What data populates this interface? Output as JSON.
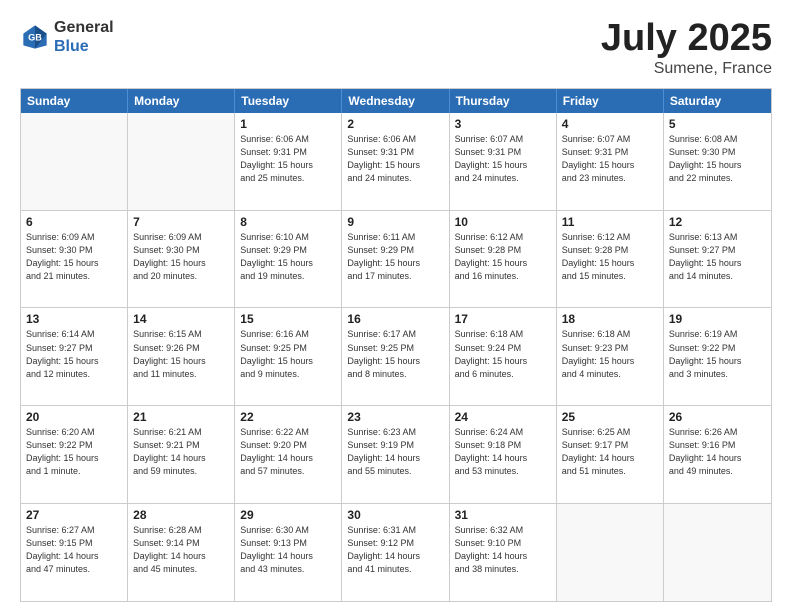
{
  "logo": {
    "general": "General",
    "blue": "Blue"
  },
  "title": {
    "month": "July 2025",
    "location": "Sumene, France"
  },
  "header_days": [
    "Sunday",
    "Monday",
    "Tuesday",
    "Wednesday",
    "Thursday",
    "Friday",
    "Saturday"
  ],
  "weeks": [
    [
      {
        "day": "",
        "info": ""
      },
      {
        "day": "",
        "info": ""
      },
      {
        "day": "1",
        "info": "Sunrise: 6:06 AM\nSunset: 9:31 PM\nDaylight: 15 hours\nand 25 minutes."
      },
      {
        "day": "2",
        "info": "Sunrise: 6:06 AM\nSunset: 9:31 PM\nDaylight: 15 hours\nand 24 minutes."
      },
      {
        "day": "3",
        "info": "Sunrise: 6:07 AM\nSunset: 9:31 PM\nDaylight: 15 hours\nand 24 minutes."
      },
      {
        "day": "4",
        "info": "Sunrise: 6:07 AM\nSunset: 9:31 PM\nDaylight: 15 hours\nand 23 minutes."
      },
      {
        "day": "5",
        "info": "Sunrise: 6:08 AM\nSunset: 9:30 PM\nDaylight: 15 hours\nand 22 minutes."
      }
    ],
    [
      {
        "day": "6",
        "info": "Sunrise: 6:09 AM\nSunset: 9:30 PM\nDaylight: 15 hours\nand 21 minutes."
      },
      {
        "day": "7",
        "info": "Sunrise: 6:09 AM\nSunset: 9:30 PM\nDaylight: 15 hours\nand 20 minutes."
      },
      {
        "day": "8",
        "info": "Sunrise: 6:10 AM\nSunset: 9:29 PM\nDaylight: 15 hours\nand 19 minutes."
      },
      {
        "day": "9",
        "info": "Sunrise: 6:11 AM\nSunset: 9:29 PM\nDaylight: 15 hours\nand 17 minutes."
      },
      {
        "day": "10",
        "info": "Sunrise: 6:12 AM\nSunset: 9:28 PM\nDaylight: 15 hours\nand 16 minutes."
      },
      {
        "day": "11",
        "info": "Sunrise: 6:12 AM\nSunset: 9:28 PM\nDaylight: 15 hours\nand 15 minutes."
      },
      {
        "day": "12",
        "info": "Sunrise: 6:13 AM\nSunset: 9:27 PM\nDaylight: 15 hours\nand 14 minutes."
      }
    ],
    [
      {
        "day": "13",
        "info": "Sunrise: 6:14 AM\nSunset: 9:27 PM\nDaylight: 15 hours\nand 12 minutes."
      },
      {
        "day": "14",
        "info": "Sunrise: 6:15 AM\nSunset: 9:26 PM\nDaylight: 15 hours\nand 11 minutes."
      },
      {
        "day": "15",
        "info": "Sunrise: 6:16 AM\nSunset: 9:25 PM\nDaylight: 15 hours\nand 9 minutes."
      },
      {
        "day": "16",
        "info": "Sunrise: 6:17 AM\nSunset: 9:25 PM\nDaylight: 15 hours\nand 8 minutes."
      },
      {
        "day": "17",
        "info": "Sunrise: 6:18 AM\nSunset: 9:24 PM\nDaylight: 15 hours\nand 6 minutes."
      },
      {
        "day": "18",
        "info": "Sunrise: 6:18 AM\nSunset: 9:23 PM\nDaylight: 15 hours\nand 4 minutes."
      },
      {
        "day": "19",
        "info": "Sunrise: 6:19 AM\nSunset: 9:22 PM\nDaylight: 15 hours\nand 3 minutes."
      }
    ],
    [
      {
        "day": "20",
        "info": "Sunrise: 6:20 AM\nSunset: 9:22 PM\nDaylight: 15 hours\nand 1 minute."
      },
      {
        "day": "21",
        "info": "Sunrise: 6:21 AM\nSunset: 9:21 PM\nDaylight: 14 hours\nand 59 minutes."
      },
      {
        "day": "22",
        "info": "Sunrise: 6:22 AM\nSunset: 9:20 PM\nDaylight: 14 hours\nand 57 minutes."
      },
      {
        "day": "23",
        "info": "Sunrise: 6:23 AM\nSunset: 9:19 PM\nDaylight: 14 hours\nand 55 minutes."
      },
      {
        "day": "24",
        "info": "Sunrise: 6:24 AM\nSunset: 9:18 PM\nDaylight: 14 hours\nand 53 minutes."
      },
      {
        "day": "25",
        "info": "Sunrise: 6:25 AM\nSunset: 9:17 PM\nDaylight: 14 hours\nand 51 minutes."
      },
      {
        "day": "26",
        "info": "Sunrise: 6:26 AM\nSunset: 9:16 PM\nDaylight: 14 hours\nand 49 minutes."
      }
    ],
    [
      {
        "day": "27",
        "info": "Sunrise: 6:27 AM\nSunset: 9:15 PM\nDaylight: 14 hours\nand 47 minutes."
      },
      {
        "day": "28",
        "info": "Sunrise: 6:28 AM\nSunset: 9:14 PM\nDaylight: 14 hours\nand 45 minutes."
      },
      {
        "day": "29",
        "info": "Sunrise: 6:30 AM\nSunset: 9:13 PM\nDaylight: 14 hours\nand 43 minutes."
      },
      {
        "day": "30",
        "info": "Sunrise: 6:31 AM\nSunset: 9:12 PM\nDaylight: 14 hours\nand 41 minutes."
      },
      {
        "day": "31",
        "info": "Sunrise: 6:32 AM\nSunset: 9:10 PM\nDaylight: 14 hours\nand 38 minutes."
      },
      {
        "day": "",
        "info": ""
      },
      {
        "day": "",
        "info": ""
      }
    ]
  ]
}
